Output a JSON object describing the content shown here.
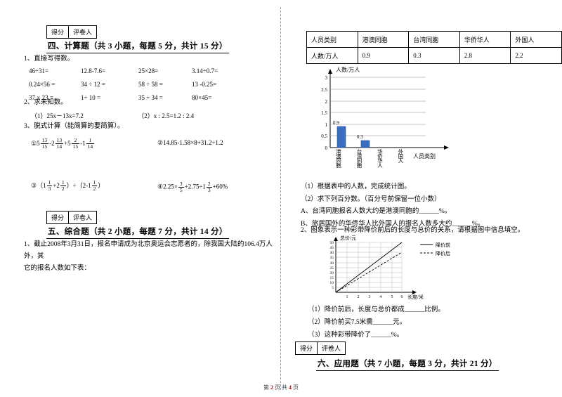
{
  "left": {
    "score_box": {
      "score_label": "得分",
      "grader_label": "评卷人"
    },
    "section4_title": "四、计算题（共 3 小题，每题 5 分，共计 15 分）",
    "q1_label": "1、直接写得数。",
    "q1_rows": [
      [
        "46÷31=",
        "12.8-7.6=",
        "25×28=",
        "3.14÷0.7="
      ],
      [
        "0.24×56 =",
        "34 ÷ 12 =",
        "58 ÷ 58 =",
        "13 -0.25="
      ],
      [
        "37 × 23 =",
        "1÷ 10 =",
        "35 ÷ 34 =",
        "80×45="
      ]
    ],
    "q2_label": "2、求未知数。",
    "q2_items": [
      "（1）25x－13x=7.2",
      "（2）x : 2.5=1.2 : 2.4"
    ],
    "q3_label": "3、脱式计算（能简算的要简算）。",
    "q3_item1_prefix": "①",
    "q3_item1_text": "5 13/15 - 2 13/14 + 5 2/15 - 1 1/14",
    "q3_item2": "②14.85-1.58×8+31.2÷1.2",
    "q3_item3_prefix": "③",
    "q3_item3_text": "(1 1/3 + 2 1/2) ÷ (2 - 1 1/2)",
    "q3_item4_prefix": "④",
    "q3_item4_text": "2.25× 3/5 + 2.75 ÷ 1 2/3 + 60%",
    "section5_title": "五、综合题（共 2 小题，每题 7 分，共计 14 分）",
    "q5_text_line1": "1、截止2008年3月31日，报名申请成为北京奥运会志愿者的，除我国大陆的106.4万人外，其",
    "q5_text_line2": "它的报名人数如下表："
  },
  "right": {
    "table": {
      "header": [
        "人员类别",
        "港澳同胞",
        "台湾同胞",
        "华侨华人",
        "外国人"
      ],
      "row": [
        "人数/万人",
        "0.9",
        "0.3",
        "2.8",
        "2.2"
      ]
    },
    "chart_data": {
      "type": "bar",
      "title": "人数/万人",
      "xlabel": "人员类别",
      "ylabel": "人数/万人",
      "categories": [
        "港澳同胞",
        "台湾同胞",
        "华侨华人",
        "外国人"
      ],
      "values": [
        0.9,
        0.3,
        null,
        null
      ],
      "value_labels": [
        "0.9",
        "0.3",
        "",
        ""
      ],
      "ylim": [
        0,
        3
      ],
      "yticks": [
        "0",
        "0.5",
        "1",
        "1.5",
        "2",
        "2.5",
        "3"
      ],
      "grid": true
    },
    "q_after_chart": [
      "（1）根据表中的人数，完成统计图。",
      "（2）求下列百分数。（百分号前保留一位小数）",
      "A、台湾同胞报名人数大约是港澳同胞的______%。",
      "B、旅居国外的华侨华人比外国人的报名人数多大约______%。"
    ],
    "q2_text": "2、图象表示一种彩带降价前后的长度与总价的关系，请根据图中信息填空。",
    "chart2": {
      "type": "line",
      "title": "总价/元",
      "xlabel": "长度/米",
      "ylabel": "总价/元",
      "legend": [
        "降价前",
        "降价后"
      ],
      "yticks": [
        "5",
        "10",
        "15",
        "20",
        "25",
        "30",
        "35",
        "40",
        "45",
        "50"
      ],
      "xticks": [
        "1",
        "2",
        "3",
        "4",
        "5",
        "6"
      ],
      "series": [
        {
          "name": "降价前",
          "points": [
            [
              0,
              0
            ],
            [
              6,
              50
            ]
          ]
        },
        {
          "name": "降价后",
          "points": [
            [
              0,
              0
            ],
            [
              6,
              40
            ]
          ]
        }
      ]
    },
    "q2_subs": [
      "（1）降价前后，长度与总价都成______比例。",
      "（2）降价前买7.5米需______元。",
      "（3）这种彩带降价了______%。"
    ],
    "score_box": {
      "score_label": "得分",
      "grader_label": "评卷人"
    },
    "section6_title": "六、应用题（共 7 小题，每题 3 分，共计 21 分）"
  },
  "footer": {
    "prefix": "第",
    "page": "2",
    "mid": "页 共",
    "total": "4",
    "suffix": "页"
  }
}
